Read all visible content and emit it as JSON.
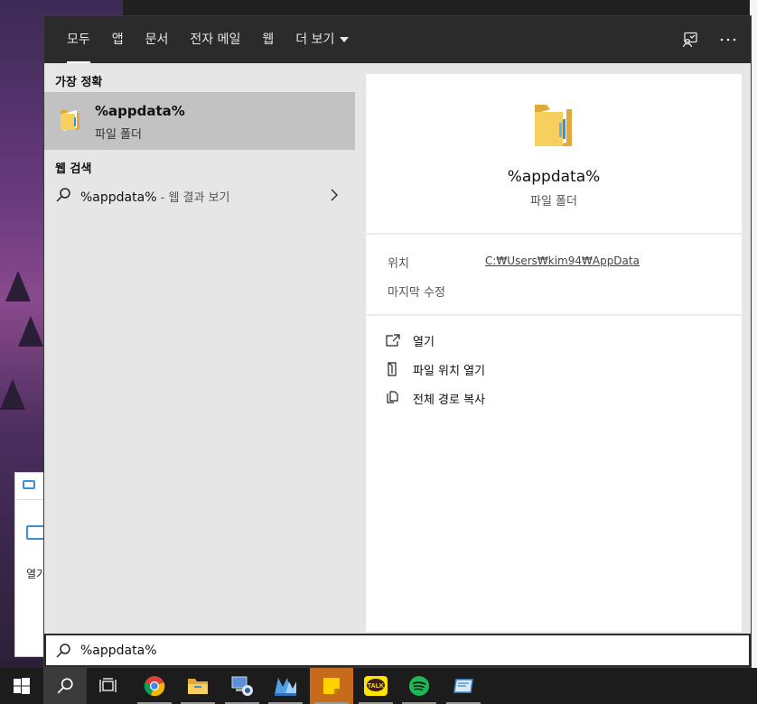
{
  "colors": {
    "topbar_bg": "#2b2b2b",
    "panel_bg": "#e6e6e6",
    "selected_bg": "#c2c2c2",
    "preview_bg": "#ffffff",
    "taskbar_bg": "#1c1c1c",
    "folder_yellow": "#f5c24a"
  },
  "background_window": {
    "open_label": "열기"
  },
  "tabs": [
    {
      "label": "모두",
      "active": true
    },
    {
      "label": "앱"
    },
    {
      "label": "문서"
    },
    {
      "label": "전자 메일"
    },
    {
      "label": "웹"
    },
    {
      "label": "더 보기"
    }
  ],
  "top_icons": [
    "feedback-icon",
    "more-options-icon"
  ],
  "results": {
    "best_match_header": "가장 정확",
    "best_match": {
      "name": "%appdata%",
      "type": "파일 폴더",
      "icon": "folder-icon"
    },
    "web_header": "웹 검색",
    "web_item": {
      "query": "%appdata%",
      "suffix": " - 웹 결과 보기",
      "icon": "search-icon"
    }
  },
  "preview": {
    "name": "%appdata%",
    "type": "파일 폴더",
    "location_label": "위치",
    "location_value": "C:₩Users₩kim94₩AppData",
    "modified_label": "마지막 수정",
    "actions": [
      {
        "label": "열기",
        "icon": "open-icon"
      },
      {
        "label": "파일 위치 열기",
        "icon": "file-location-icon"
      },
      {
        "label": "전체 경로 복사",
        "icon": "copy-icon"
      }
    ]
  },
  "search": {
    "value": "%appdata%"
  },
  "taskbar": [
    {
      "name": "windows-start-icon"
    },
    {
      "name": "search-icon",
      "active": true
    },
    {
      "name": "task-view-icon"
    },
    {
      "name": "chrome-icon",
      "running": true
    },
    {
      "name": "file-explorer-icon",
      "running": true
    },
    {
      "name": "network-app-icon",
      "running": true
    },
    {
      "name": "mame-app-icon",
      "running": true
    },
    {
      "name": "sticky-notes-icon",
      "running": true,
      "highlight": true
    },
    {
      "name": "kakaotalk-icon",
      "running": true
    },
    {
      "name": "spotify-icon",
      "running": true
    },
    {
      "name": "app-window-icon",
      "running": true
    }
  ],
  "kakaotalk_label": "TALK"
}
